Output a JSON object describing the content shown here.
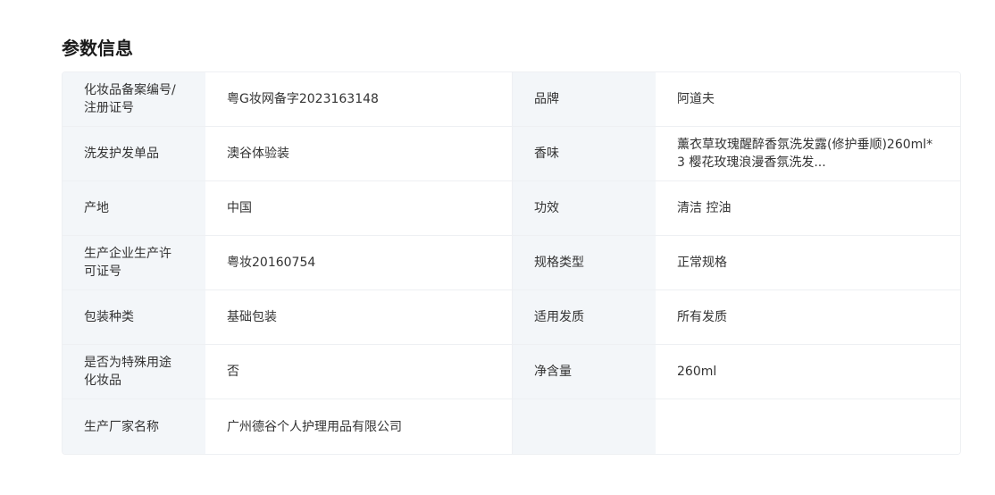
{
  "section": {
    "title": "参数信息"
  },
  "params": {
    "rows": [
      {
        "left_label": "化妆品备案编号/注册证号",
        "left_value": "粤G妆网备字2023163148",
        "right_label": "品牌",
        "right_value": "阿道夫"
      },
      {
        "left_label": "洗发护发单品",
        "left_value": "澳谷体验装",
        "right_label": "香味",
        "right_value": "薰衣草玫瑰醒醉香氛洗发露(修护垂顺)260ml*3 樱花玫瑰浪漫香氛洗发..."
      },
      {
        "left_label": "产地",
        "left_value": "中国",
        "right_label": "功效",
        "right_value": "清洁 控油"
      },
      {
        "left_label": "生产企业生产许可证号",
        "left_value": "粤妆20160754",
        "right_label": "规格类型",
        "right_value": "正常规格"
      },
      {
        "left_label": "包装种类",
        "left_value": "基础包装",
        "right_label": "适用发质",
        "right_value": "所有发质"
      },
      {
        "left_label": "是否为特殊用途化妆品",
        "left_value": "否",
        "right_label": "净含量",
        "right_value": "260ml"
      },
      {
        "left_label": "生产厂家名称",
        "left_value": "广州德谷个人护理用品有限公司",
        "right_label": "",
        "right_value": ""
      }
    ]
  }
}
